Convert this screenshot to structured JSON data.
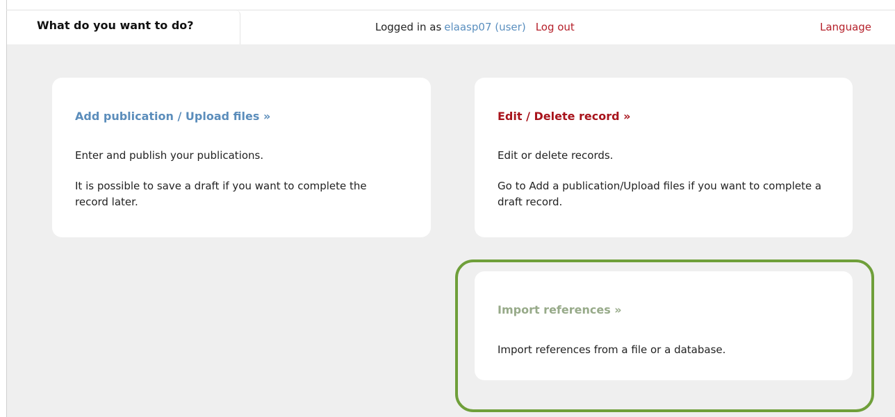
{
  "tab": {
    "label": "What do you want to do?"
  },
  "header": {
    "logged_in_prefix": "Logged in as",
    "user": "elaasp07 (user)",
    "logout": "Log out",
    "language": "Language"
  },
  "cards": {
    "add": {
      "title": "Add publication / Upload files »",
      "p1": "Enter and publish your publications.",
      "p2": "It is possible to save a draft if you want to complete the record later."
    },
    "edit": {
      "title": "Edit / Delete record »",
      "p1": "Edit or delete records.",
      "p2": "Go to Add a publication/Upload files if you want to complete a draft record."
    },
    "import": {
      "title": "Import references »",
      "p1": "Import references from a file or a database."
    }
  },
  "colors": {
    "link_blue": "#5b8dbb",
    "link_red": "#a8141c",
    "link_green": "#97aa89",
    "highlight_green": "#6f9f3a",
    "content_bg": "#efefef"
  }
}
